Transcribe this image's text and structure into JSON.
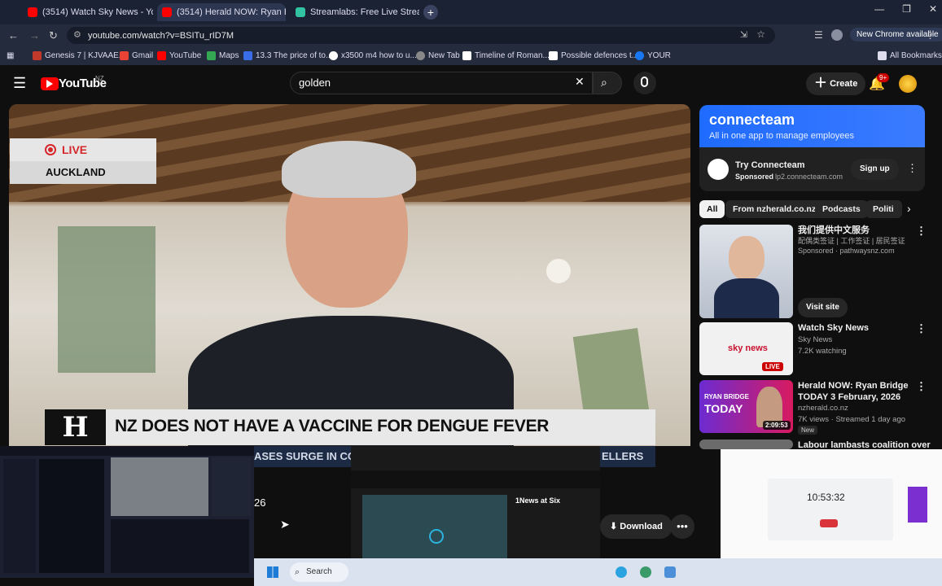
{
  "browser": {
    "tabs": [
      {
        "title": "(3514) Watch Sky News - YouTube",
        "color": "#ff0000"
      },
      {
        "title": "(3514) Herald NOW: Ryan B",
        "color": "#ff0000"
      },
      {
        "title": "Streamlabs: Free Live Streaming",
        "color": "#31c3a2"
      }
    ],
    "url": "youtube.com/watch?v=BSITu_rID7M",
    "new_chrome": "New Chrome available",
    "bookmarks": [
      {
        "label": "Genesis 7 | KJVAAE...",
        "color": "#c0392b"
      },
      {
        "label": "Gmail",
        "color": "#ea4335"
      },
      {
        "label": "YouTube",
        "color": "#ff0000"
      },
      {
        "label": "Maps",
        "color": "#34a853"
      },
      {
        "label": "13.3 The price of to...",
        "color": "#3a6ee8"
      },
      {
        "label": "x3500 m4 how to u...",
        "color": "#ffffff"
      },
      {
        "label": "New Tab",
        "color": "#888888"
      },
      {
        "label": "Timeline of Roman...",
        "color": "#ffffff"
      },
      {
        "label": "Possible defences t...",
        "color": "#ffffff"
      },
      {
        "label": "YOUR",
        "color": "#1877f2"
      }
    ],
    "all_bookmarks": "All Bookmarks"
  },
  "youtube": {
    "logo": "YouTube",
    "region": "NZ",
    "search_value": "golden",
    "create_label": "Create",
    "notif_badge": "9+"
  },
  "video": {
    "live_label": "LIVE",
    "location": "AUCKLAND",
    "headline": "NZ DOES NOT HAVE A VACCINE FOR DENGUE FEVER",
    "ticker_left": "ASES SURGE IN CO",
    "ticker_right": "ELLERS",
    "download_label": "Download"
  },
  "ad": {
    "brand": "connecteam",
    "tagline": "All in one app to manage employees",
    "title": "Try Connecteam",
    "sponsored": "Sponsored",
    "domain": "lp2.connecteam.com",
    "cta": "Sign up"
  },
  "chips": [
    "All",
    "From nzherald.co.nz",
    "Podcasts",
    "Politi"
  ],
  "sidebar": [
    {
      "title": "我们提供中文服务",
      "sub": "配偶类签证 | 工作签证 | 居民签证",
      "meta": "Sponsored · pathwaysnz.com",
      "cta": "Visit site"
    },
    {
      "title": "Watch Sky News",
      "channel": "Sky News",
      "meta": "7.2K watching",
      "badge": "LIVE"
    },
    {
      "title": "Herald NOW: Ryan Bridge TODAY 3 February, 2026",
      "channel": "nzherald.co.nz",
      "meta": "7K views · Streamed 1 day ago",
      "tag": "New",
      "duration": "2:09:53"
    },
    {
      "title": "Labour lambasts coalition over"
    }
  ],
  "overlays": {
    "clock": "10:53:32",
    "news_title": "1News at Six",
    "taskbar_search": "Search",
    "partial_number": "26"
  }
}
